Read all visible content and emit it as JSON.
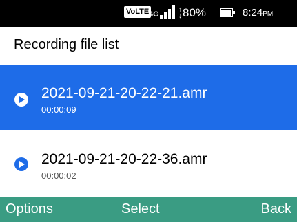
{
  "status_bar": {
    "volte": "VoLTE",
    "network": "4G",
    "battery_percent": "80%",
    "time": "8:24",
    "ampm": "PM",
    "icons": [
      "signal-icon",
      "data-arrows-icon",
      "battery-icon"
    ]
  },
  "header": {
    "title": "Recording file list"
  },
  "recordings": [
    {
      "name": "2021-09-21-20-22-21.amr",
      "duration": "00:00:09",
      "selected": true
    },
    {
      "name": "2021-09-21-20-22-36.amr",
      "duration": "00:00:02",
      "selected": false
    }
  ],
  "softkeys": {
    "left": "Options",
    "center": "Select",
    "right": "Back"
  },
  "colors": {
    "selected_row": "#1e6ce8",
    "softkey_bar": "#3a9c83",
    "status_bar": "#000000",
    "play_icon": "#1e6ce8"
  }
}
